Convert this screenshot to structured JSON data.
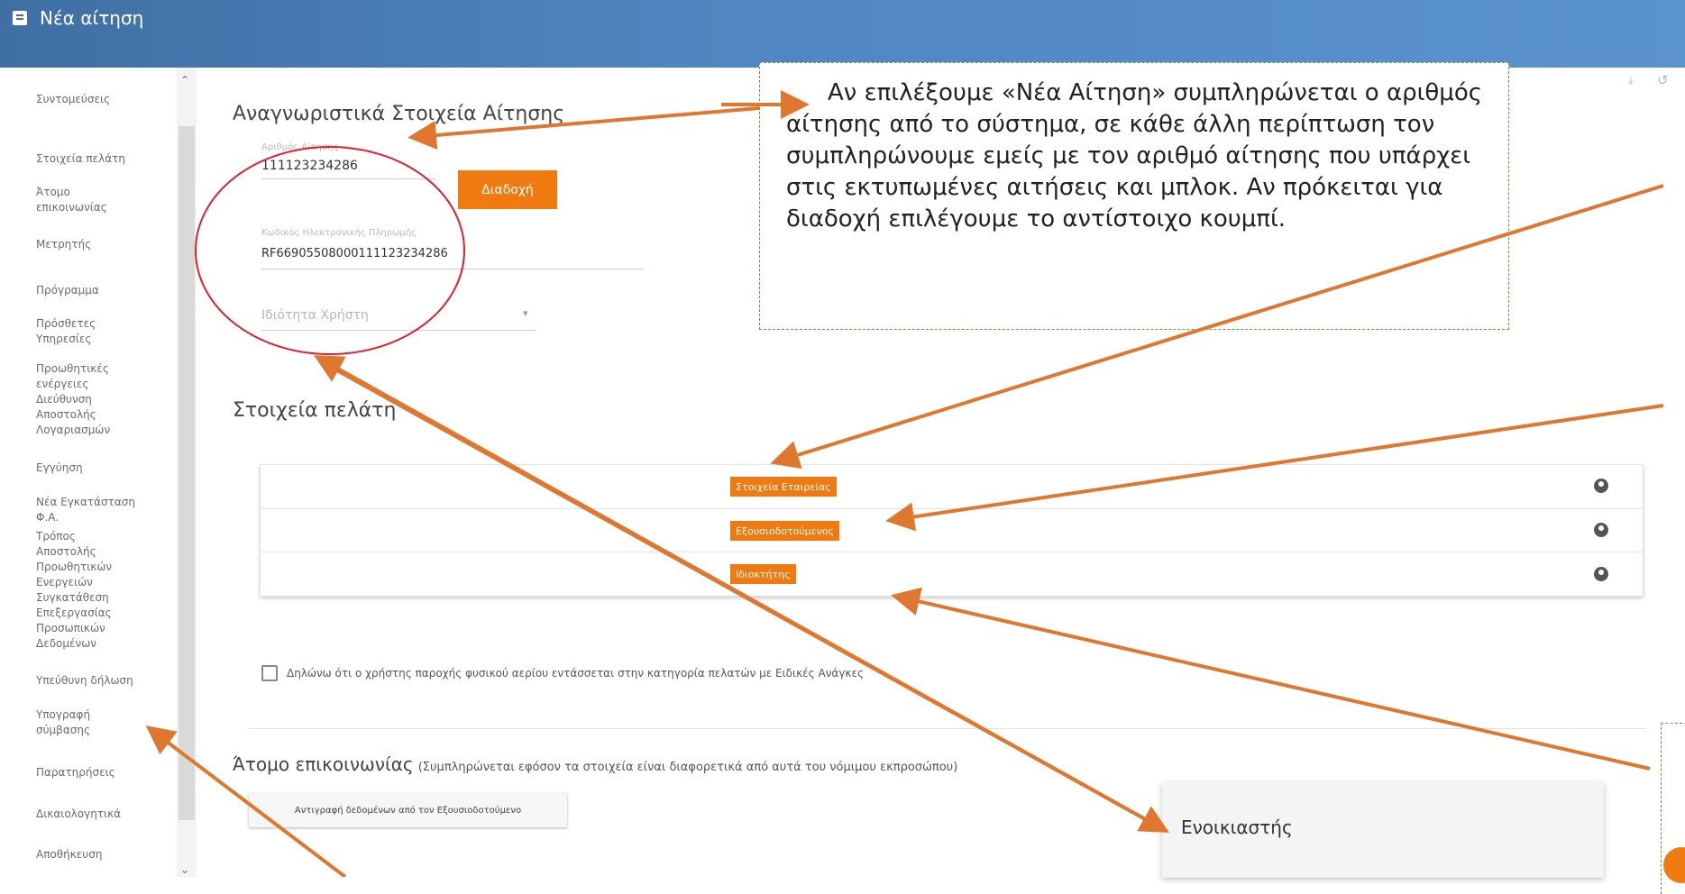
{
  "header": {
    "title": "Νέα αίτηση",
    "accent_color": "#4f85c0"
  },
  "sidebar": {
    "items": [
      "Συντομεύσεις",
      "Στοιχεία πελάτη",
      "Άτομο επικοινωνίας",
      "Μετρητής",
      "Πρόγραμμα",
      "Πρόσθετες Υπηρεσίες",
      "Προωθητικές ενέργειες",
      "Διεύθυνση Αποστολής Λογαριασμών",
      "Εγγύηση",
      "Νέα Εγκατάσταση Φ.Α.",
      "Τρόπος Αποστολής Προωθητικών Ενεργειών",
      "Συγκατάθεση Επεξεργασίας Προσωπικών Δεδομένων",
      "Υπεύθυνη δήλωση",
      "Υπογραφή σύμβασης",
      "Παρατηρήσεις",
      "Δικαιολογητικά",
      "Αποθήκευση"
    ]
  },
  "application": {
    "section_title": "Αναγνωριστικά Στοιχεία Αίτησης",
    "application_number_label": "Αριθμός Αίτησης",
    "application_number": "111123234286",
    "payment_code_label": "Κωδικός Ηλεκτρονικής Πληρωμής",
    "payment_code": "RF66905508000111123234286",
    "user_capacity_placeholder": "Ιδιότητα Χρήστη",
    "succession_button": "Διαδοχή"
  },
  "customer": {
    "section_title": "Στοιχεία πελάτη",
    "rows": [
      "Στοιχεία Εταιρείας",
      "Εξουσιοδοτούμενος",
      "Ιδιοκτήτης"
    ]
  },
  "declaration": {
    "checkbox_label": "Δηλώνω ότι ο χρήστης παροχής φυσικού αερίου εντάσσεται στην κατηγορία πελατών με Ειδικές Ανάγκες"
  },
  "contact": {
    "section_title": "Άτομο επικοινωνίας",
    "section_note": "(Συμπληρώνεται εφόσον τα στοιχεία είναι διαφορετικά από αυτά του νόμιμου εκπροσώπου)",
    "copy_button": "Αντιγραφή δεδομένων από τον Εξουσιοδοτούμενο"
  },
  "dropdown": {
    "option": "Ενοικιαστής"
  },
  "callout": {
    "text": "Αν επιλέξουμε «Νέα Αίτηση» συμπληρώνεται ο αριθμός αίτησης από το σύστημα, σε κάθε άλλη περίπτωση τον συμπληρώνουμε εμείς με τον αριθμό αίτησης που υπάρχει στις εκτυπωμένες αιτήσεις και μπλοκ. Αν πρόκειται για διαδοχή επιλέγουμε το αντίστοιχο κουμπί."
  },
  "colors": {
    "orange": "#f07a10",
    "callout_border": "#5a9d3a",
    "arrow": "#e0772f"
  }
}
